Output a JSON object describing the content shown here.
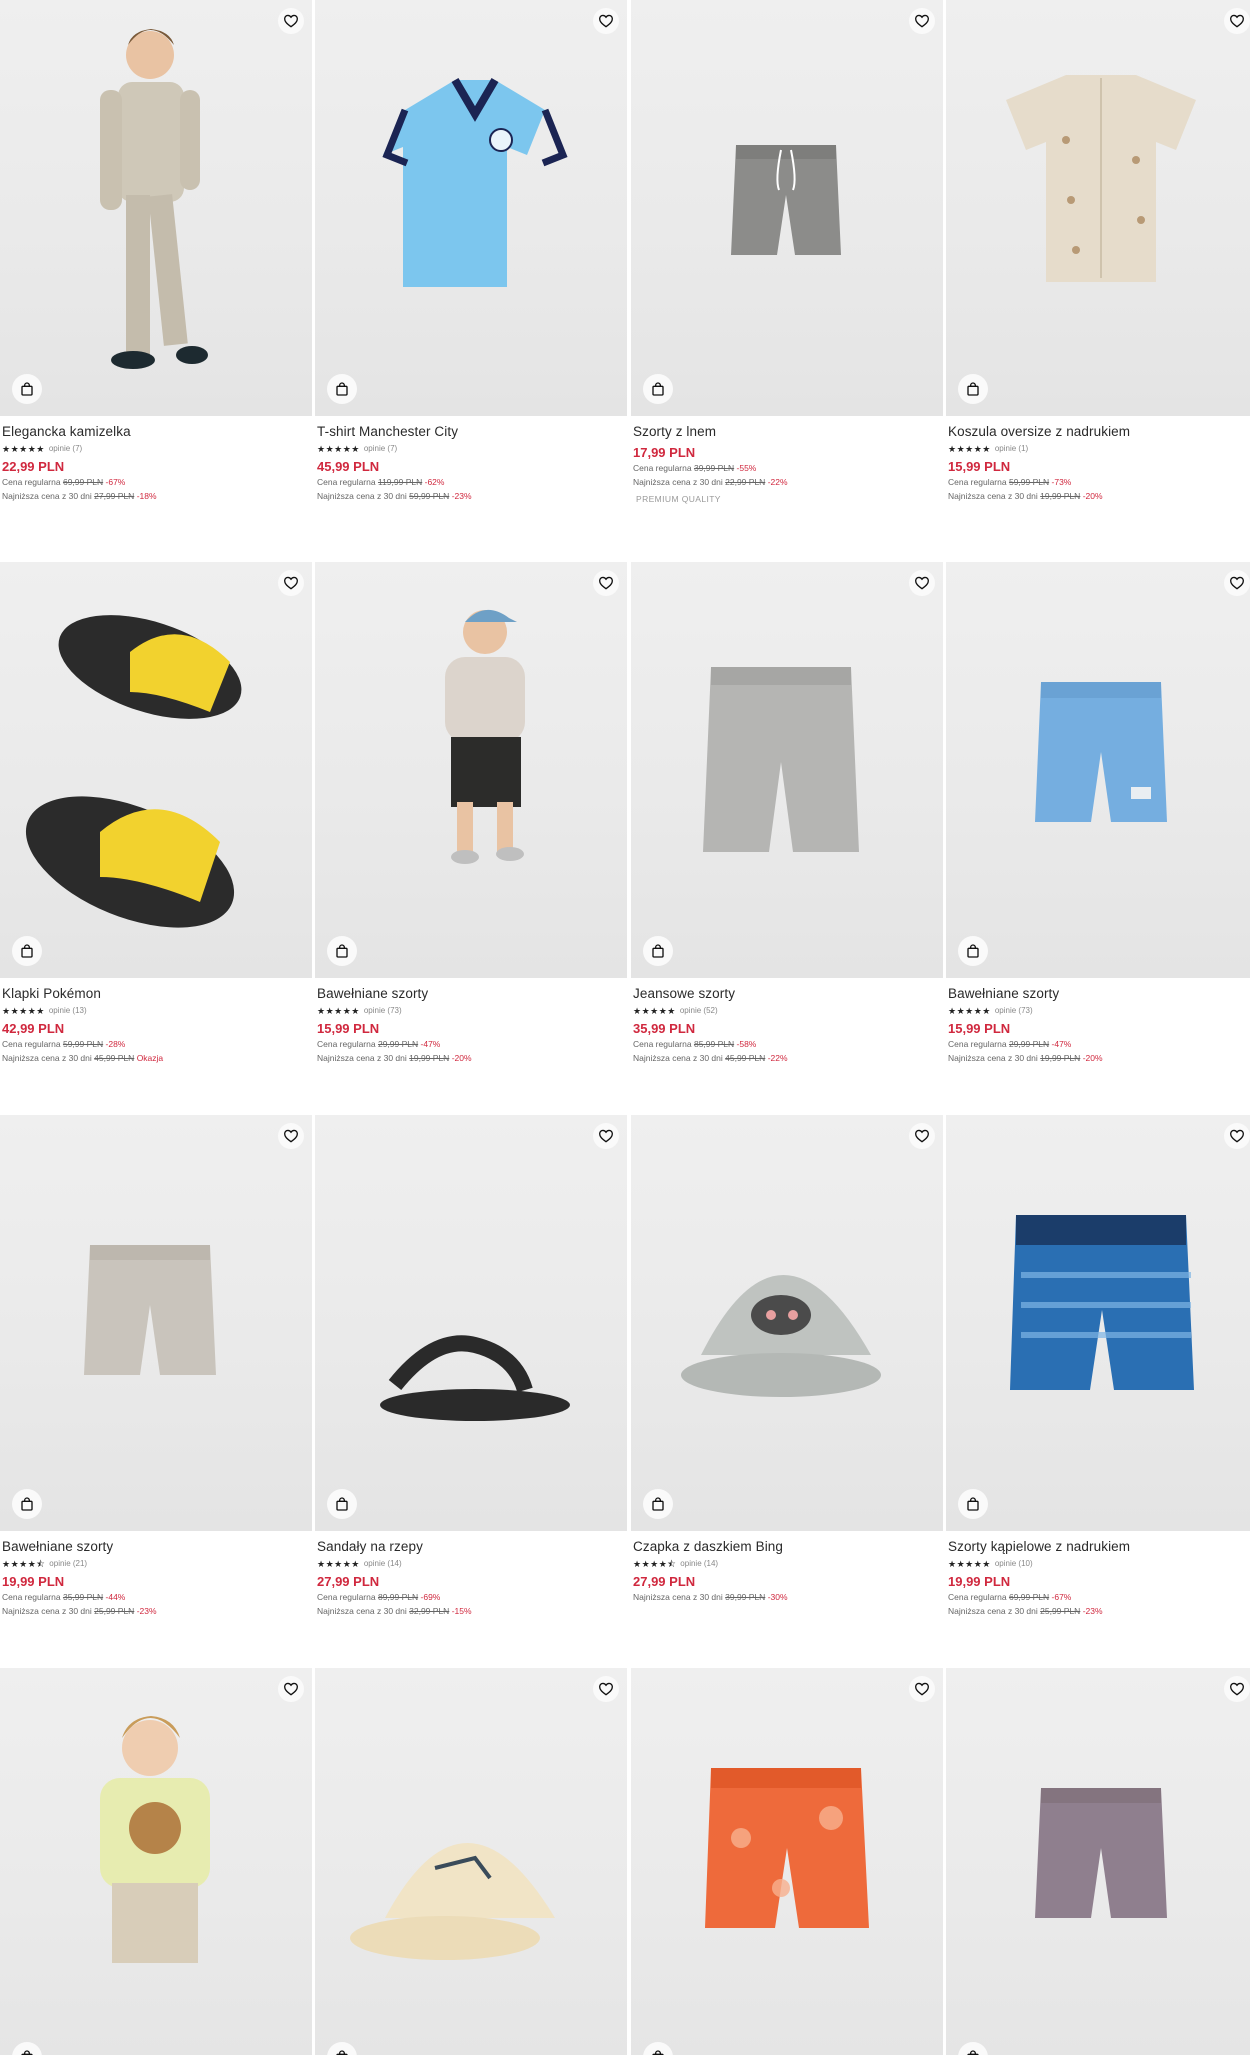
{
  "icons": {
    "favorite": "heart-outline-icon",
    "add_to_cart": "shopping-bag-icon"
  },
  "colors": {
    "price": "#d0283e",
    "text": "#2a2a2a",
    "muted": "#666666"
  },
  "products": [
    {
      "name": "Elegancka kamizelka",
      "stars": "★★★★★",
      "reviews": "opinie (7)",
      "price": "22,99 PLN",
      "lines": [
        {
          "label": "Cena regularna",
          "old": "69,99 PLN",
          "disc": "-67%"
        },
        {
          "label": "Najniższa cena z 30 dni",
          "old": "27,99 PLN",
          "disc": "-18%"
        }
      ],
      "tag": ""
    },
    {
      "name": "T-shirt Manchester City",
      "stars": "★★★★★",
      "reviews": "opinie (7)",
      "price": "45,99 PLN",
      "lines": [
        {
          "label": "Cena regularna",
          "old": "119,99 PLN",
          "disc": "-62%"
        },
        {
          "label": "Najniższa cena z 30 dni",
          "old": "59,99 PLN",
          "disc": "-23%"
        }
      ],
      "tag": ""
    },
    {
      "name": "Szorty z lnem",
      "stars": "",
      "reviews": "",
      "price": "17,99 PLN",
      "lines": [
        {
          "label": "Cena regularna",
          "old": "39,99 PLN",
          "disc": "-55%"
        },
        {
          "label": "Najniższa cena z 30 dni",
          "old": "22,99 PLN",
          "disc": "-22%"
        }
      ],
      "tag": "PREMIUM QUALITY"
    },
    {
      "name": "Koszula oversize z nadrukiem",
      "stars": "★★★★★",
      "reviews": "opinie (1)",
      "price": "15,99 PLN",
      "lines": [
        {
          "label": "Cena regularna",
          "old": "59,99 PLN",
          "disc": "-73%"
        },
        {
          "label": "Najniższa cena z 30 dni",
          "old": "19,99 PLN",
          "disc": "-20%"
        }
      ],
      "tag": ""
    },
    {
      "name": "Klapki Pokémon",
      "stars": "★★★★★",
      "reviews": "opinie (13)",
      "price": "42,99 PLN",
      "lines": [
        {
          "label": "Cena regularna",
          "old": "59,99 PLN",
          "disc": "-28%"
        },
        {
          "label": "Najniższa cena z 30 dni",
          "old": "45,99 PLN",
          "disc": "Okazja"
        }
      ],
      "tag": ""
    },
    {
      "name": "Bawełniane szorty",
      "stars": "★★★★★",
      "reviews": "opinie (73)",
      "price": "15,99 PLN",
      "lines": [
        {
          "label": "Cena regularna",
          "old": "29,99 PLN",
          "disc": "-47%"
        },
        {
          "label": "Najniższa cena z 30 dni",
          "old": "19,99 PLN",
          "disc": "-20%"
        }
      ],
      "tag": ""
    },
    {
      "name": "Jeansowe szorty",
      "stars": "★★★★★",
      "reviews": "opinie (52)",
      "price": "35,99 PLN",
      "lines": [
        {
          "label": "Cena regularna",
          "old": "85,99 PLN",
          "disc": "-58%"
        },
        {
          "label": "Najniższa cena z 30 dni",
          "old": "45,99 PLN",
          "disc": "-22%"
        }
      ],
      "tag": ""
    },
    {
      "name": "Bawełniane szorty",
      "stars": "★★★★★",
      "reviews": "opinie (73)",
      "price": "15,99 PLN",
      "lines": [
        {
          "label": "Cena regularna",
          "old": "29,99 PLN",
          "disc": "-47%"
        },
        {
          "label": "Najniższa cena z 30 dni",
          "old": "19,99 PLN",
          "disc": "-20%"
        }
      ],
      "tag": ""
    },
    {
      "name": "Bawełniane szorty",
      "stars": "★★★★⯪",
      "reviews": "opinie (21)",
      "price": "19,99 PLN",
      "lines": [
        {
          "label": "Cena regularna",
          "old": "35,99 PLN",
          "disc": "-44%"
        },
        {
          "label": "Najniższa cena z 30 dni",
          "old": "25,99 PLN",
          "disc": "-23%"
        }
      ],
      "tag": ""
    },
    {
      "name": "Sandały na rzepy",
      "stars": "★★★★★",
      "reviews": "opinie (14)",
      "price": "27,99 PLN",
      "lines": [
        {
          "label": "Cena regularna",
          "old": "89,99 PLN",
          "disc": "-69%"
        },
        {
          "label": "Najniższa cena z 30 dni",
          "old": "32,99 PLN",
          "disc": "-15%"
        }
      ],
      "tag": ""
    },
    {
      "name": "Czapka z daszkiem Bing",
      "stars": "★★★★⯪",
      "reviews": "opinie (14)",
      "price": "27,99 PLN",
      "lines": [
        {
          "label": "Najniższa cena z 30 dni",
          "old": "39,99 PLN",
          "disc": "-30%"
        }
      ],
      "tag": ""
    },
    {
      "name": "Szorty kąpielowe z nadrukiem",
      "stars": "★★★★★",
      "reviews": "opinie (10)",
      "price": "19,99 PLN",
      "lines": [
        {
          "label": "Cena regularna",
          "old": "69,99 PLN",
          "disc": "-67%"
        },
        {
          "label": "Najniższa cena z 30 dni",
          "old": "25,99 PLN",
          "disc": "-23%"
        }
      ],
      "tag": ""
    },
    {
      "name": "",
      "stars": "",
      "reviews": "",
      "price": "",
      "lines": [],
      "tag": ""
    },
    {
      "name": "",
      "stars": "",
      "reviews": "",
      "price": "",
      "lines": [],
      "tag": ""
    },
    {
      "name": "",
      "stars": "",
      "reviews": "",
      "price": "",
      "lines": [],
      "tag": ""
    },
    {
      "name": "",
      "stars": "",
      "reviews": "",
      "price": "",
      "lines": [],
      "tag": ""
    }
  ]
}
